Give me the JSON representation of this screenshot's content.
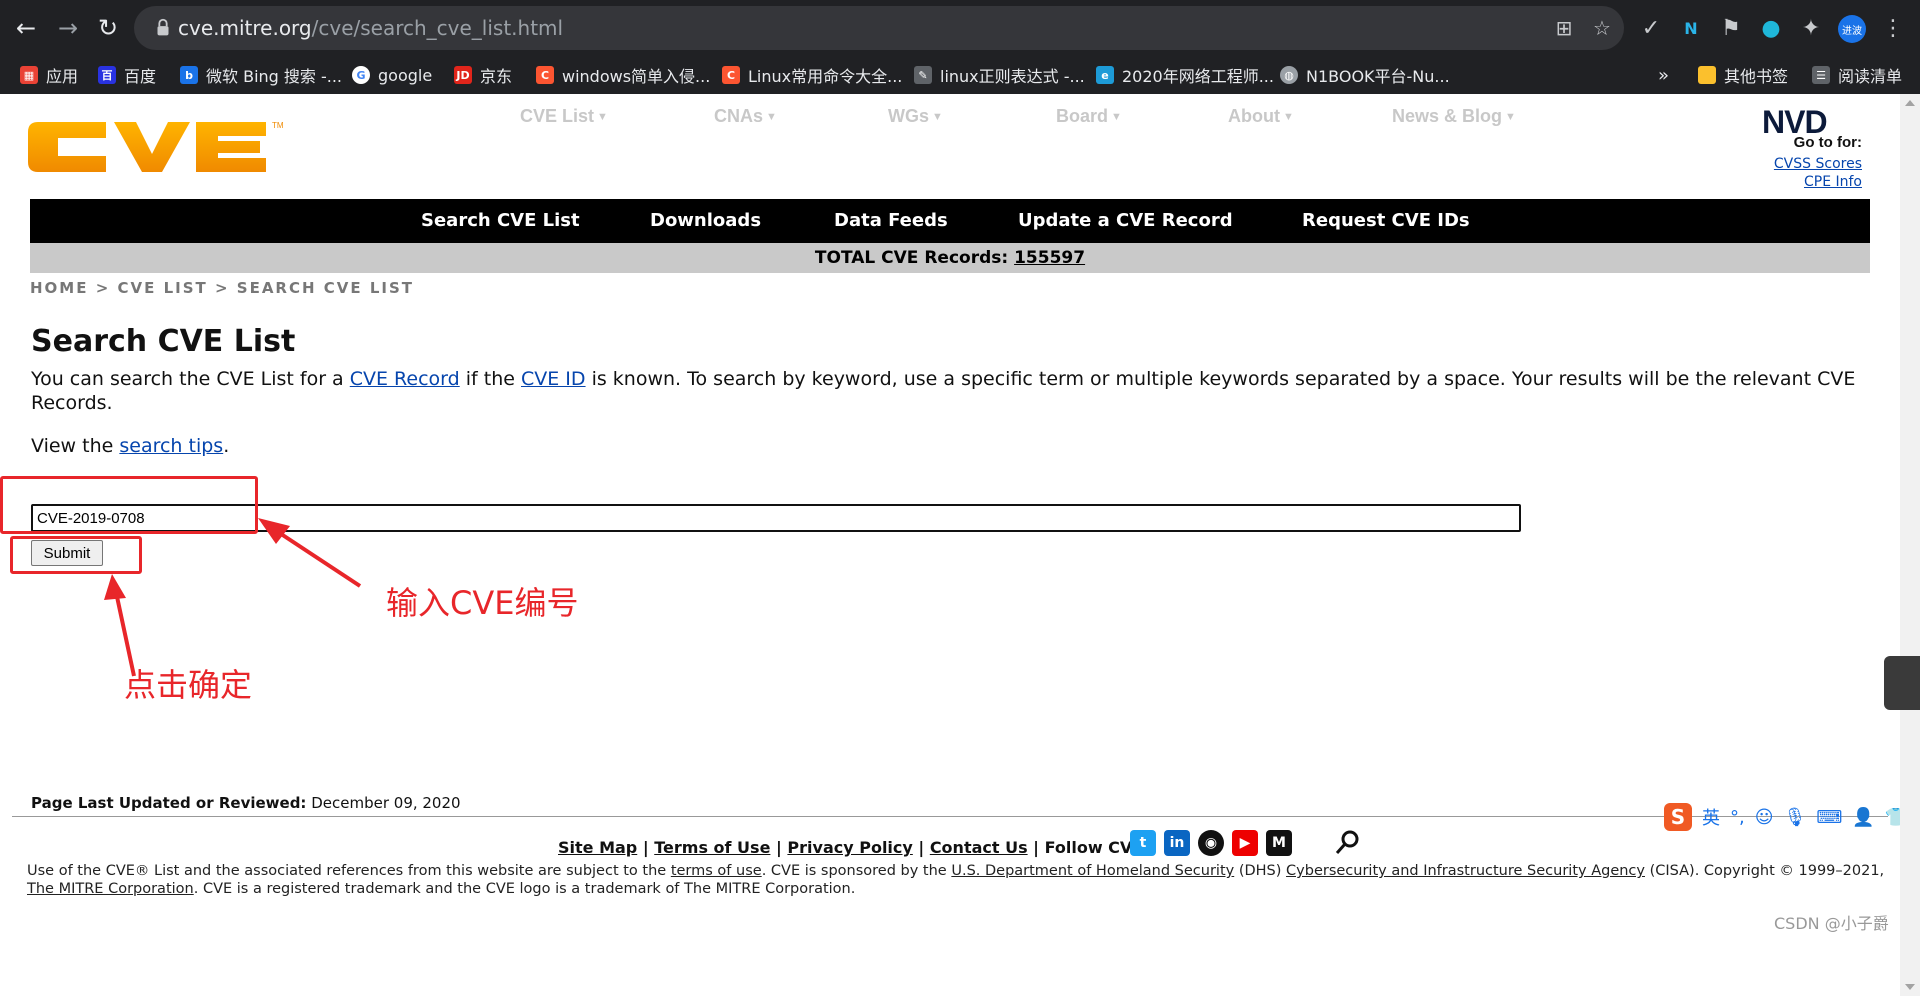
{
  "browser": {
    "url_host": "cve.mitre.org",
    "url_path": "/cve/search_cve_list.html",
    "avatar_text": "进波",
    "bookmarks": [
      {
        "label": "应用",
        "icon": "apps-grid-icon",
        "color": "#e94235"
      },
      {
        "label": "百度",
        "icon": "baidu-icon",
        "color": "#2932e1"
      },
      {
        "label": "微软 Bing 搜索 -...",
        "icon": "bing-icon",
        "color": "#1a73e8"
      },
      {
        "label": "google",
        "icon": "google-icon",
        "color": "#ffffff"
      },
      {
        "label": "京东",
        "icon": "jd-icon",
        "color": "#e1251b"
      },
      {
        "label": "windows简单入侵...",
        "icon": "csdn-icon",
        "color": "#fc5531"
      },
      {
        "label": "Linux常用命令大全...",
        "icon": "csdn-icon",
        "color": "#fc5531"
      },
      {
        "label": "linux正则表达式 -...",
        "icon": "bookmark-site-icon",
        "color": "#9aa0a6"
      },
      {
        "label": "2020年网络工程师...",
        "icon": "ie-icon",
        "color": "#1d9bd7"
      },
      {
        "label": "N1BOOK平台-Nu...",
        "icon": "globe-icon",
        "color": "#9aa0a6"
      }
    ],
    "bookmarks_overflow": "»",
    "other_bookmarks": "其他书签",
    "reading_list": "阅读清单"
  },
  "site": {
    "logo_text": "CVE",
    "nav": [
      "CVE List",
      "CNAs",
      "WGs",
      "Board",
      "About",
      "News & Blog"
    ],
    "nvd": {
      "logo": "NVD",
      "goto": "Go to for:",
      "cvss": "CVSS Scores",
      "cpe": "CPE Info"
    },
    "blackbar": [
      "Search CVE List",
      "Downloads",
      "Data Feeds",
      "Update a CVE Record",
      "Request CVE IDs"
    ],
    "total_label": "TOTAL CVE Records:",
    "total_value": "155597",
    "breadcrumb": "HOME > CVE LIST > SEARCH CVE LIST"
  },
  "main": {
    "title": "Search CVE List",
    "intro_1": "You can search the CVE List for a ",
    "intro_link1": "CVE Record",
    "intro_2": " if the ",
    "intro_link2": "CVE ID",
    "intro_3": " is known. To search by keyword, use a specific term or multiple keywords separated by a space. Your results will be the relevant CVE Records.",
    "tips_pre": "View the ",
    "tips_link": "search tips",
    "tips_post": ".",
    "search_value": "CVE-2019-0708",
    "submit": "Submit"
  },
  "annotations": {
    "input_hint": "输入CVE编号",
    "click_hint": "点击确定",
    "color": "#e8262a"
  },
  "footer": {
    "last_updated_label": "Page Last Updated or Reviewed:",
    "last_updated_value": "December 09, 2020",
    "links": [
      "Site Map",
      "Terms of Use",
      "Privacy Policy",
      "Contact Us"
    ],
    "follow": "Follow CVE",
    "legal_1": "Use of the CVE® List and the associated references from this website are subject to the ",
    "legal_terms": "terms of use",
    "legal_2": ". CVE is sponsored by the ",
    "legal_dhs": "U.S. Department of Homeland Security",
    "legal_3": " (DHS) ",
    "legal_cisa": "Cybersecurity and Infrastructure Security Agency",
    "legal_4": " (CISA). Copyright © 1999–2021, ",
    "legal_mitre": "The MITRE Corporation",
    "legal_5": ". CVE is a registered trademark and the CVE logo is a trademark of The MITRE Corporation."
  },
  "watermark": "CSDN @小子爵",
  "ime": {
    "label": "英"
  }
}
